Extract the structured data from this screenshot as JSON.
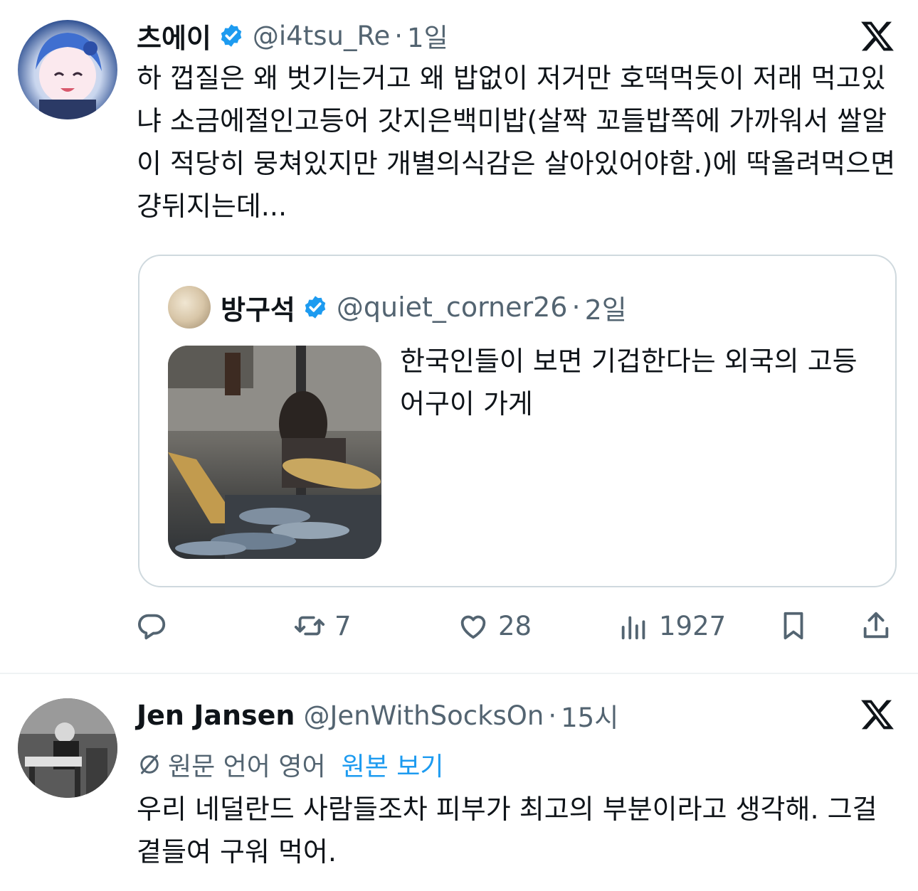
{
  "tweets": [
    {
      "name": "츠에이",
      "handle": "@i4tsu_Re",
      "dot": "·",
      "time": "1일",
      "text": "하 껍질은 왜 벗기는거고 왜 밥없이 저거만 호떡먹듯이 저래 먹고있냐 소금에절인고등어 갓지은백미밥(살짝 꼬들밥쪽에 가까워서 쌀알이 적당히 뭉쳐있지만 개별의식감은 살아있어야함.)에 딱올려먹으면 걍뒤지는데...",
      "quote": {
        "name": "방구석",
        "handle": "@quiet_corner26",
        "dot": "·",
        "time": "2일",
        "text": "한국인들이 보면 기겁한다는 외국의 고등어구이 가게"
      },
      "actions": {
        "reply": "",
        "retweet": "7",
        "like": "28",
        "views": "1927"
      }
    },
    {
      "name": "Jen Jansen",
      "handle": "@JenWithSocksOn",
      "dot": "·",
      "time": "15시",
      "translation_label": "원문 언어 영어",
      "translation_link": "원본 보기",
      "text": "우리 네덜란드 사람들조차 피부가 최고의 부분이라고 생각해. 그걸 곁들여 구워 먹어."
    }
  ],
  "colors": {
    "text": "#0f1419",
    "secondary": "#536471",
    "verified": "#1d9bf0",
    "link": "#1d9bf0",
    "border": "#cfd9de"
  },
  "icons": [
    "verified-badge-icon",
    "x-logo-icon",
    "reply-icon",
    "retweet-icon",
    "like-icon",
    "views-icon",
    "bookmark-icon",
    "share-icon",
    "translate-icon"
  ]
}
